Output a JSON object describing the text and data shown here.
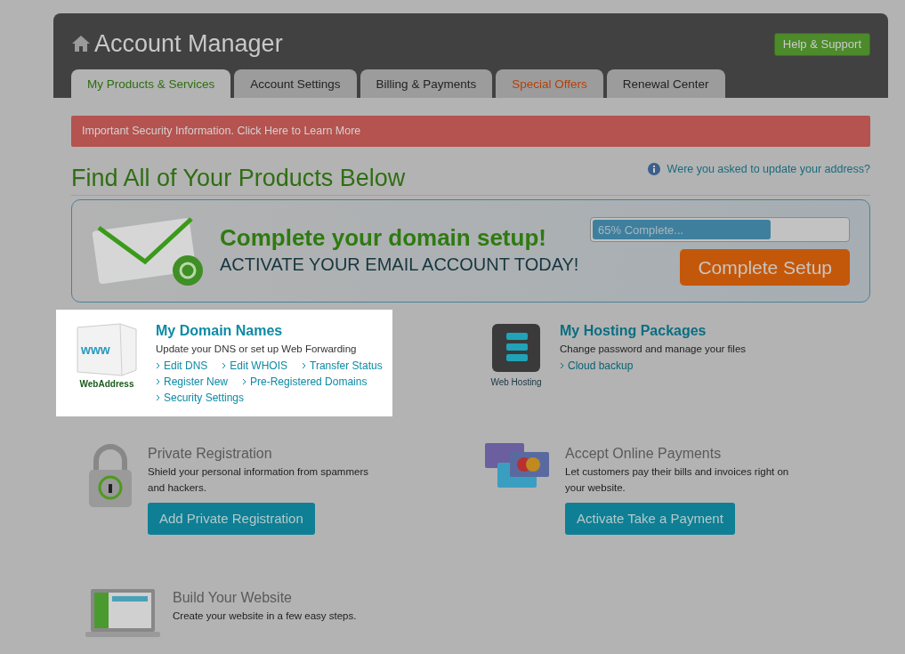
{
  "header": {
    "title": "Account Manager",
    "help_button": "Help & Support"
  },
  "tabs": [
    {
      "label": "My Products & Services",
      "selected": true,
      "kind": "normal"
    },
    {
      "label": "Account Settings",
      "selected": false,
      "kind": "normal"
    },
    {
      "label": "Billing & Payments",
      "selected": false,
      "kind": "normal"
    },
    {
      "label": "Special Offers",
      "selected": false,
      "kind": "promo"
    },
    {
      "label": "Renewal Center",
      "selected": false,
      "kind": "normal"
    }
  ],
  "alert": "Important Security Information. Click Here to Learn More",
  "heading": "Find All of Your Products Below",
  "address_link": "Were you asked to update your address?",
  "promo": {
    "title": "Complete your domain setup!",
    "subtitle": "ACTIVATE YOUR EMAIL ACCOUNT TODAY!",
    "progress": {
      "level": 0.7,
      "reading": "65% Complete..."
    },
    "button": "Complete Setup"
  },
  "products": [
    {
      "kind": "domains",
      "highlighted": true,
      "title": "My Domain Names",
      "icon_text": "www",
      "icon_caption": "WebAddress",
      "description": "Update your DNS or set up Web Forwarding",
      "links": [
        [
          "Edit DNS",
          "Edit WHOIS",
          "Transfer Status"
        ],
        [
          "Register New",
          "Pre-Registered Domains"
        ],
        [
          "Security Settings"
        ]
      ]
    },
    {
      "kind": "hosting",
      "highlighted": false,
      "title": "My Hosting Packages",
      "icon_caption": "Web Hosting",
      "description": "Change password and manage your files",
      "links": [
        [
          "Cloud backup"
        ]
      ]
    },
    {
      "kind": "privacy",
      "highlighted": false,
      "title": "Private Registration",
      "description": "Shield your personal information from spammers and hackers.",
      "button": "Add Private Registration"
    },
    {
      "kind": "payments",
      "highlighted": false,
      "title": "Accept Online Payments",
      "description": "Let customers pay their bills and invoices right on your website.",
      "button": "Activate Take a Payment"
    },
    {
      "kind": "website",
      "highlighted": false,
      "title": "Build Your Website",
      "description": "Create your website in a few easy steps."
    }
  ]
}
